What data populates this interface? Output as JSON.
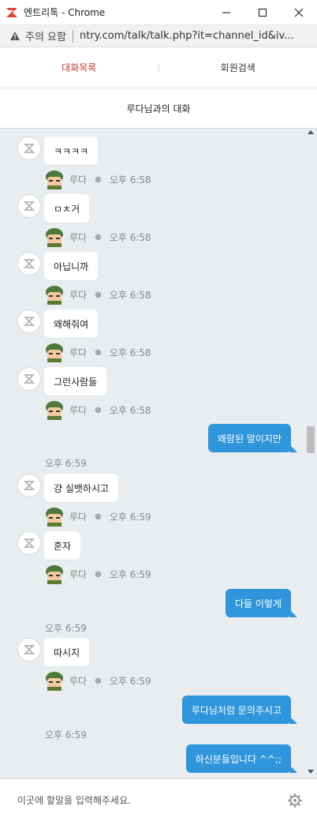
{
  "window": {
    "title": "엔트리톡 - Chrome",
    "minimize_icon": "minimize-icon",
    "maximize_icon": "maximize-icon",
    "close_icon": "close-icon"
  },
  "address": {
    "warning": "주의 요함",
    "url": "ntry.com/talk/talk.php?it=channel_id&iv..."
  },
  "tabs": [
    {
      "label": "대화목록",
      "active": true
    },
    {
      "label": "회원검색",
      "active": false
    }
  ],
  "conversation": {
    "title": "루다님과의 대화"
  },
  "messages": [
    {
      "dir": "in",
      "text": "ㅋㅋㅋㅋ",
      "name": "루다",
      "time": "오후 6:58"
    },
    {
      "dir": "in",
      "text": "ㅁㅊ거",
      "name": "루다",
      "time": "오후 6:58"
    },
    {
      "dir": "in",
      "text": "아닙니까",
      "name": "루다",
      "time": "오후 6:58"
    },
    {
      "dir": "in",
      "text": "왜해줘여",
      "name": "루다",
      "time": "오후 6:58"
    },
    {
      "dir": "in",
      "text": "그런사람들",
      "name": "루다",
      "time": "오후 6:58"
    },
    {
      "dir": "out",
      "text": "왜람된 말이지만",
      "time": "오후 6:59"
    },
    {
      "dir": "in",
      "text": "걍 실뱃하시고",
      "name": "루다",
      "time": "오후 6:59"
    },
    {
      "dir": "in",
      "text": "혼자",
      "name": "루다",
      "time": "오후 6:59"
    },
    {
      "dir": "out",
      "text": "다들 이렇게",
      "time": "오후 6:59"
    },
    {
      "dir": "in",
      "text": "따시지",
      "name": "루다",
      "time": "오후 6:59"
    },
    {
      "dir": "out",
      "text": "루다님처럼 문의주시고",
      "time": "오후 6:59"
    },
    {
      "dir": "out",
      "text": "하신분들입니다 ^^;;",
      "time": ""
    }
  ],
  "input": {
    "placeholder": "이곳에 할말을 입력해주세요."
  },
  "colors": {
    "active_tab": "#c0392b",
    "outgoing_bubble": "#2f96dc",
    "chat_background": "#eaedef"
  }
}
